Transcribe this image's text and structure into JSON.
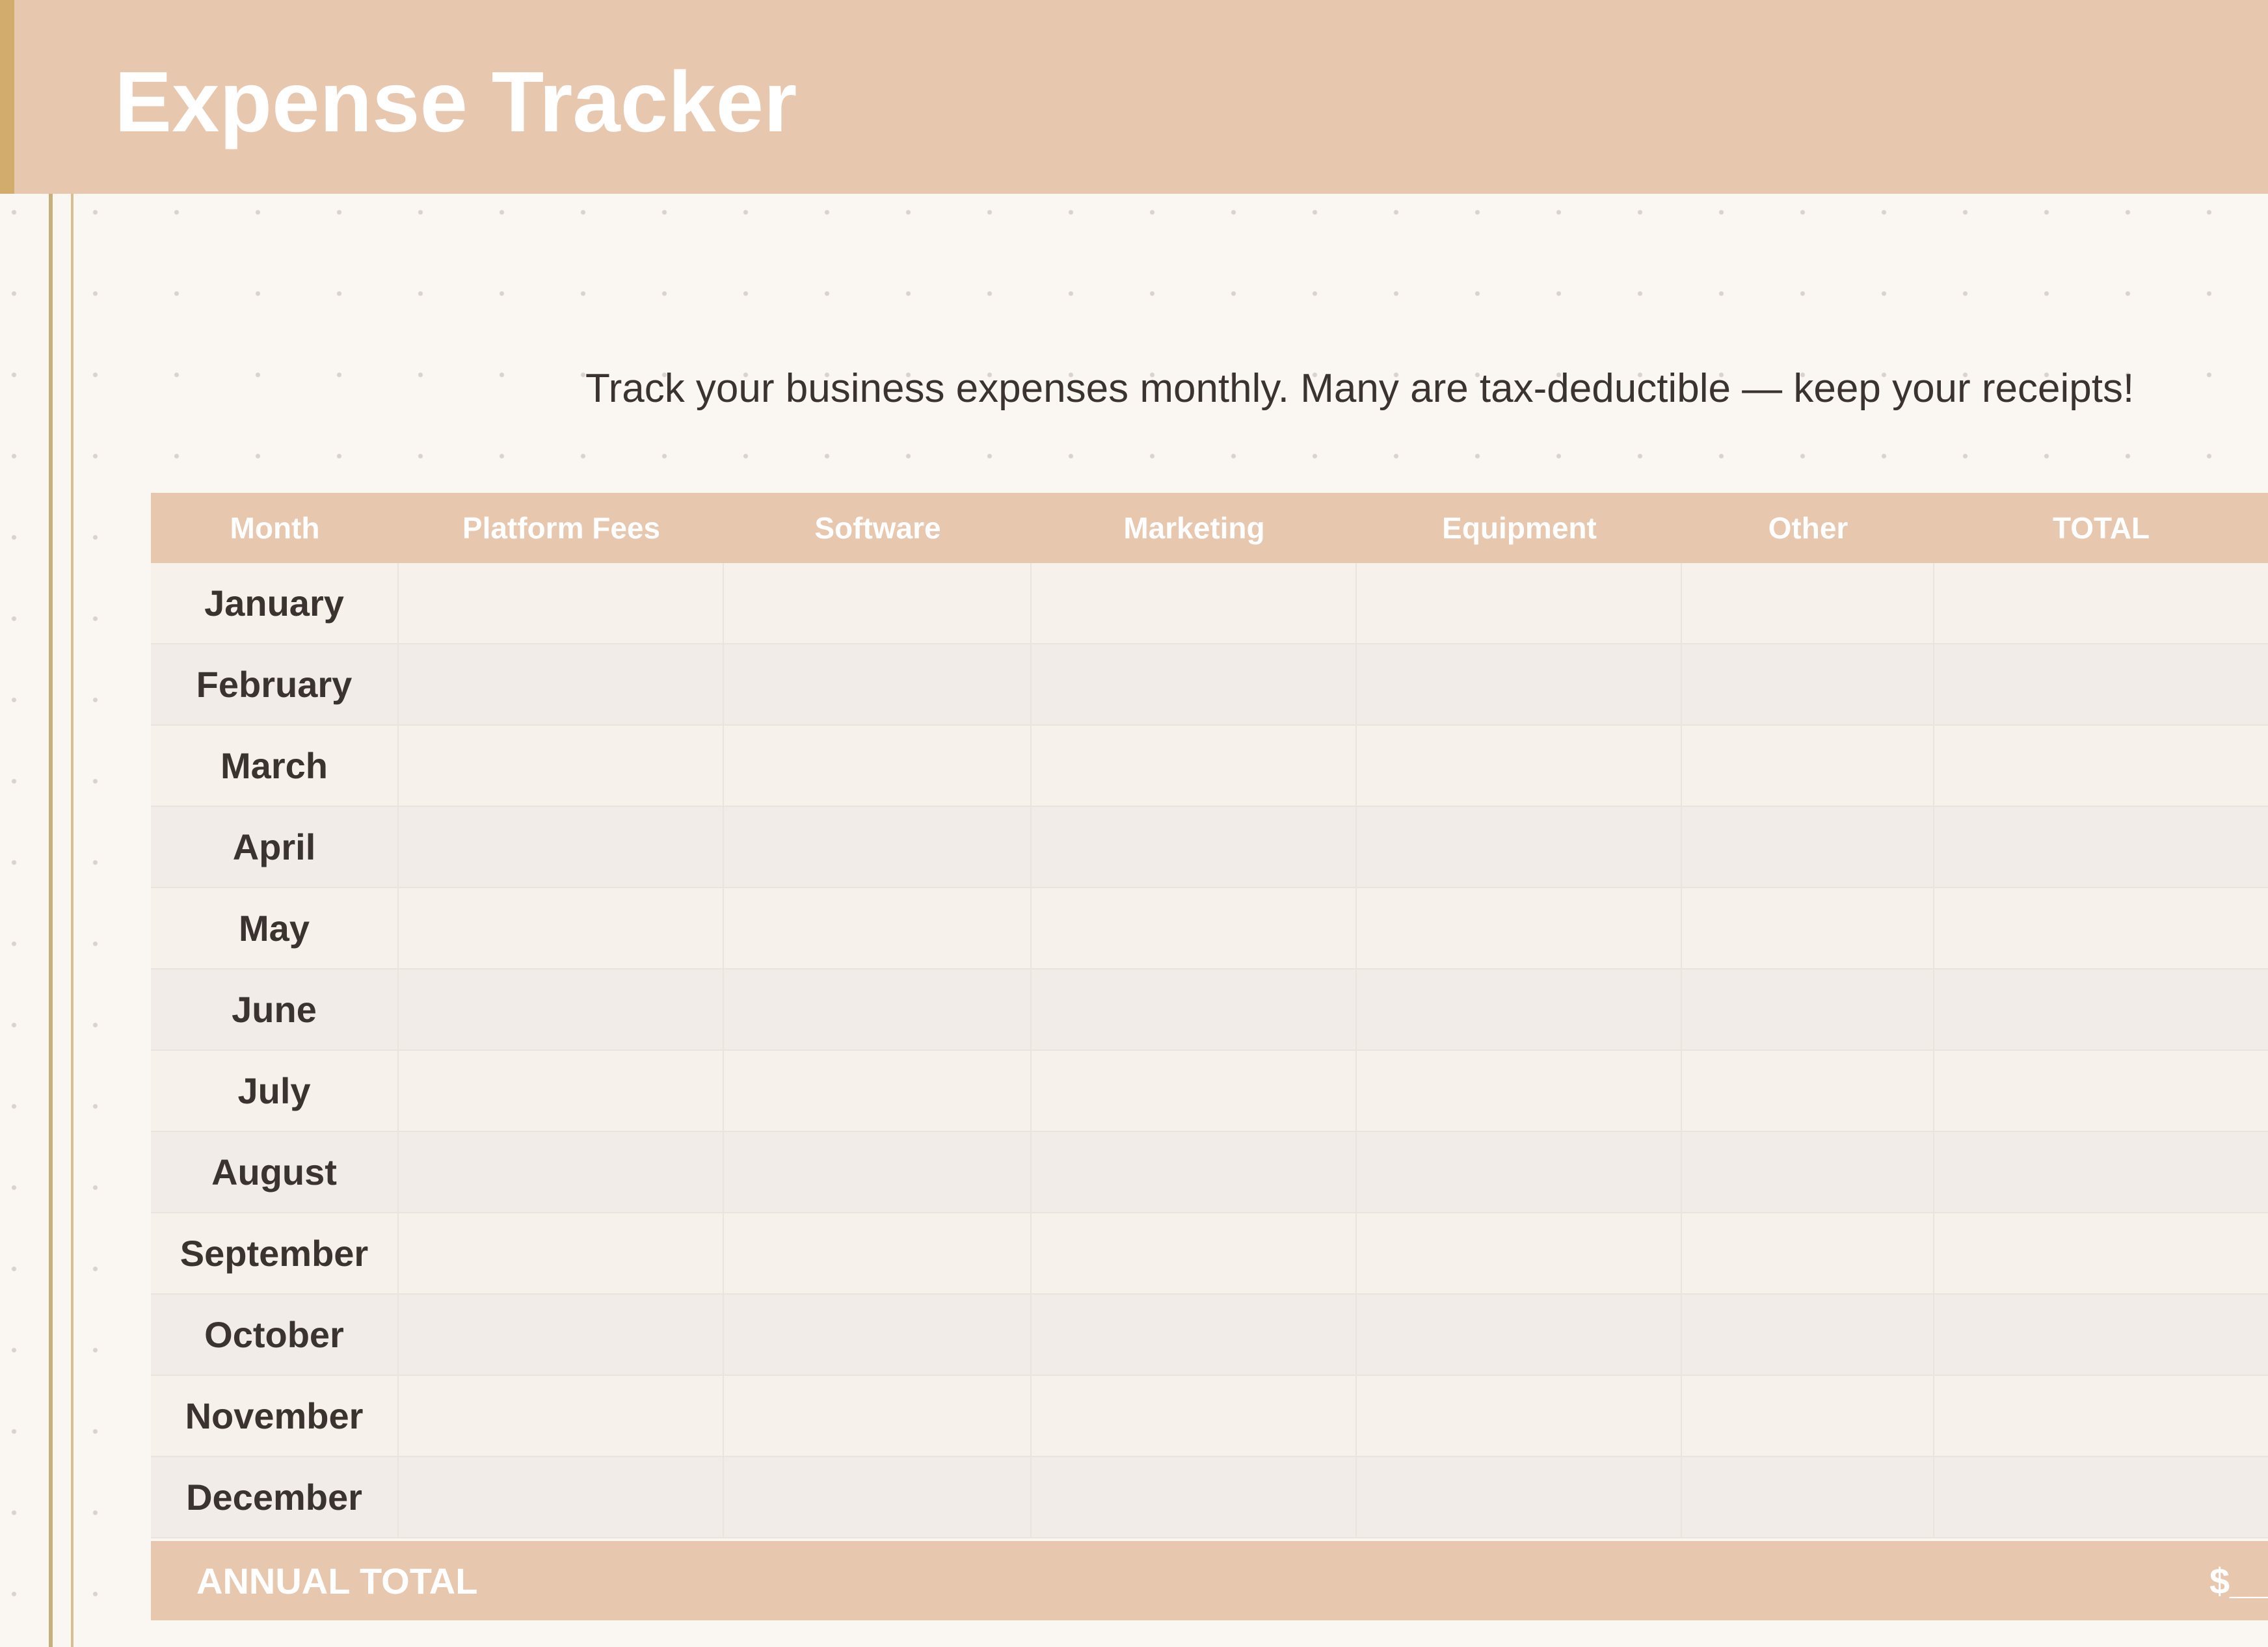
{
  "header": {
    "title": "Expense Tracker"
  },
  "tagline": "Track your business expenses monthly. Many are tax-deductible — keep your receipts!",
  "table": {
    "columns": [
      "Month",
      "Platform Fees",
      "Software",
      "Marketing",
      "Equipment",
      "Other",
      "TOTAL"
    ],
    "months": [
      "January",
      "February",
      "March",
      "April",
      "May",
      "June",
      "July",
      "August",
      "September",
      "October",
      "November",
      "December"
    ]
  },
  "annual_total": {
    "label": "ANNUAL TOTAL",
    "value": "$__"
  },
  "colors": {
    "header_bg": "#e8c7af",
    "accent": "#d1ac6c",
    "page_bg": "#faf6f2",
    "text": "#3b3330"
  }
}
